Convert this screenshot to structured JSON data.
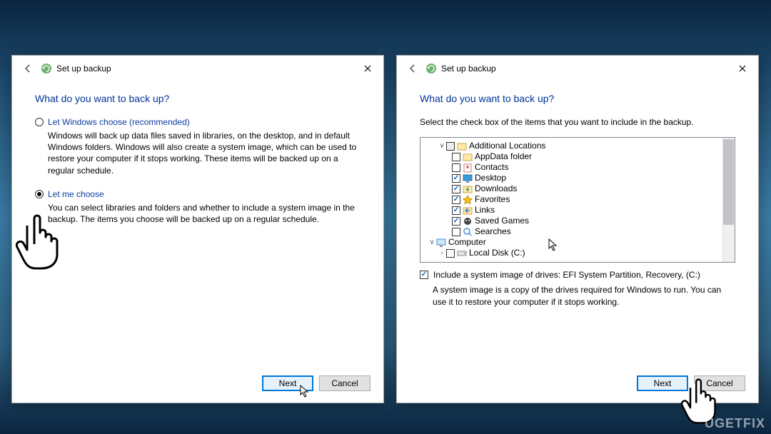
{
  "watermark": "UGETFIX",
  "left": {
    "title": "Set up backup",
    "heading": "What do you want to back up?",
    "opt1_label": "Let Windows choose (recommended)",
    "opt1_desc": "Windows will back up data files saved in libraries, on the desktop, and in default Windows folders. Windows will also create a system image, which can be used to restore your computer if it stops working. These items will be backed up on a regular schedule.",
    "opt2_label": "Let me choose",
    "opt2_desc": "You can select libraries and folders and whether to include a system image in the backup. The items you choose will be backed up on a regular schedule.",
    "next": "Next",
    "cancel": "Cancel"
  },
  "right": {
    "title": "Set up backup",
    "heading": "What do you want to back up?",
    "instruction": "Select the check box of the items that you want to include in the backup.",
    "tree": {
      "root": "Additional Locations",
      "items": [
        {
          "label": "AppData folder",
          "checked": false,
          "icon": "folder"
        },
        {
          "label": "Contacts",
          "checked": false,
          "icon": "contacts"
        },
        {
          "label": "Desktop",
          "checked": true,
          "icon": "desktop"
        },
        {
          "label": "Downloads",
          "checked": true,
          "icon": "downloads"
        },
        {
          "label": "Favorites",
          "checked": true,
          "icon": "favorites"
        },
        {
          "label": "Links",
          "checked": true,
          "icon": "links"
        },
        {
          "label": "Saved Games",
          "checked": true,
          "icon": "games"
        },
        {
          "label": "Searches",
          "checked": false,
          "icon": "search"
        }
      ],
      "computer": "Computer",
      "drive": "Local Disk (C:)"
    },
    "sysimg_label": "Include a system image of drives: EFI System Partition, Recovery, (C:)",
    "sysimg_desc": "A system image is a copy of the drives required for Windows to run. You can use it to restore your computer if it stops working.",
    "next": "Next",
    "cancel": "Cancel"
  }
}
